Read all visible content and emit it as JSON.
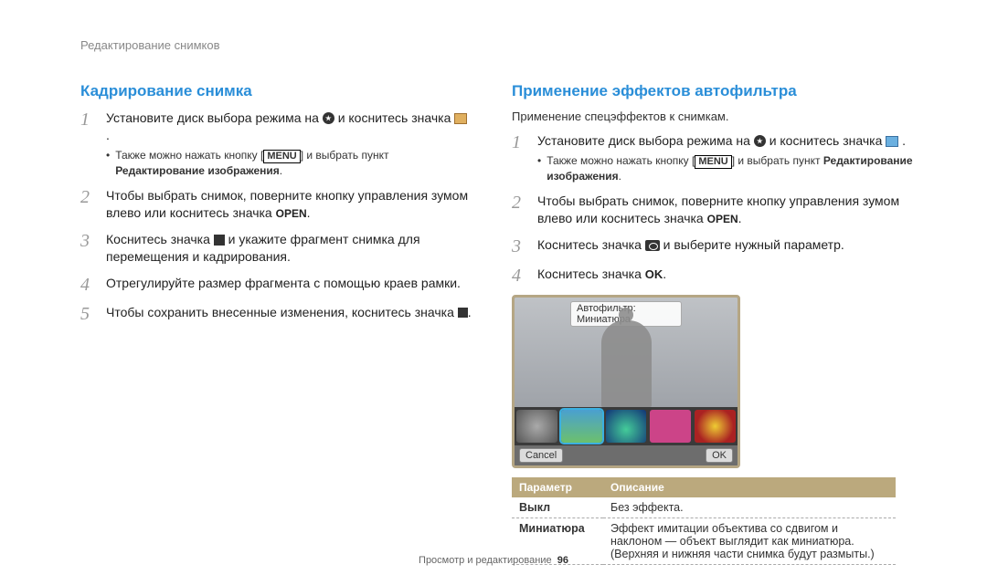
{
  "header": {
    "breadcrumb": "Редактирование снимков"
  },
  "left": {
    "title": "Кадрирование снимка",
    "steps": [
      {
        "pre": "Установите диск выбора режима на ",
        "mid": " и коснитесь значка ",
        "post": ".",
        "bullet_pre": "Также можно нажать кнопку [",
        "bullet_menu": "MENU",
        "bullet_rest": "] и выбрать пункт ",
        "bullet_bold": "Редактирование изображения",
        "bullet_end": "."
      },
      {
        "text_pre": "Чтобы выбрать снимок, поверните кнопку управления зумом влево или коснитесь значка ",
        "open": "OPEN",
        "text_post": "."
      },
      {
        "text_pre": "Коснитесь значка ",
        "text_post": " и укажите фрагмент снимка для перемещения и кадрирования."
      },
      {
        "text": "Отрегулируйте размер фрагмента с помощью краев рамки."
      },
      {
        "text_pre": "Чтобы сохранить внесенные изменения, коснитесь значка ",
        "text_post": "."
      }
    ]
  },
  "right": {
    "title": "Применение эффектов автофильтра",
    "subtitle": "Применение спецэффектов к снимкам.",
    "steps": [
      {
        "pre": "Установите диск выбора режима на ",
        "mid": " и коснитесь значка ",
        "post": ".",
        "bullet_pre": "Также можно нажать кнопку [",
        "bullet_menu": "MENU",
        "bullet_rest": "] и выбрать пункт ",
        "bullet_bold": "Редактирование изображения",
        "bullet_end": "."
      },
      {
        "text_pre": "Чтобы выбрать снимок, поверните кнопку управления зумом влево или коснитесь значка ",
        "open": "OPEN",
        "text_post": "."
      },
      {
        "text_pre": "Коснитесь значка ",
        "text_post": " и выберите нужный параметр."
      },
      {
        "text_pre": "Коснитесь значка ",
        "ok": "OK",
        "text_post": "."
      }
    ],
    "camera_label": "Автофильтр: Миниатюра",
    "camera_cancel": "Cancel",
    "camera_ok": "OK",
    "table": {
      "col1": "Параметр",
      "col2": "Описание",
      "rows": [
        {
          "name": "Выкл",
          "desc": "Без эффекта."
        },
        {
          "name": "Миниатюра",
          "desc": "Эффект имитации объектива со сдвигом и наклоном — объект выглядит как миниатюра. (Верхняя и нижняя части снимка будут размыты.)"
        }
      ]
    }
  },
  "footer": {
    "text": "Просмотр и редактирование",
    "page": "96"
  }
}
